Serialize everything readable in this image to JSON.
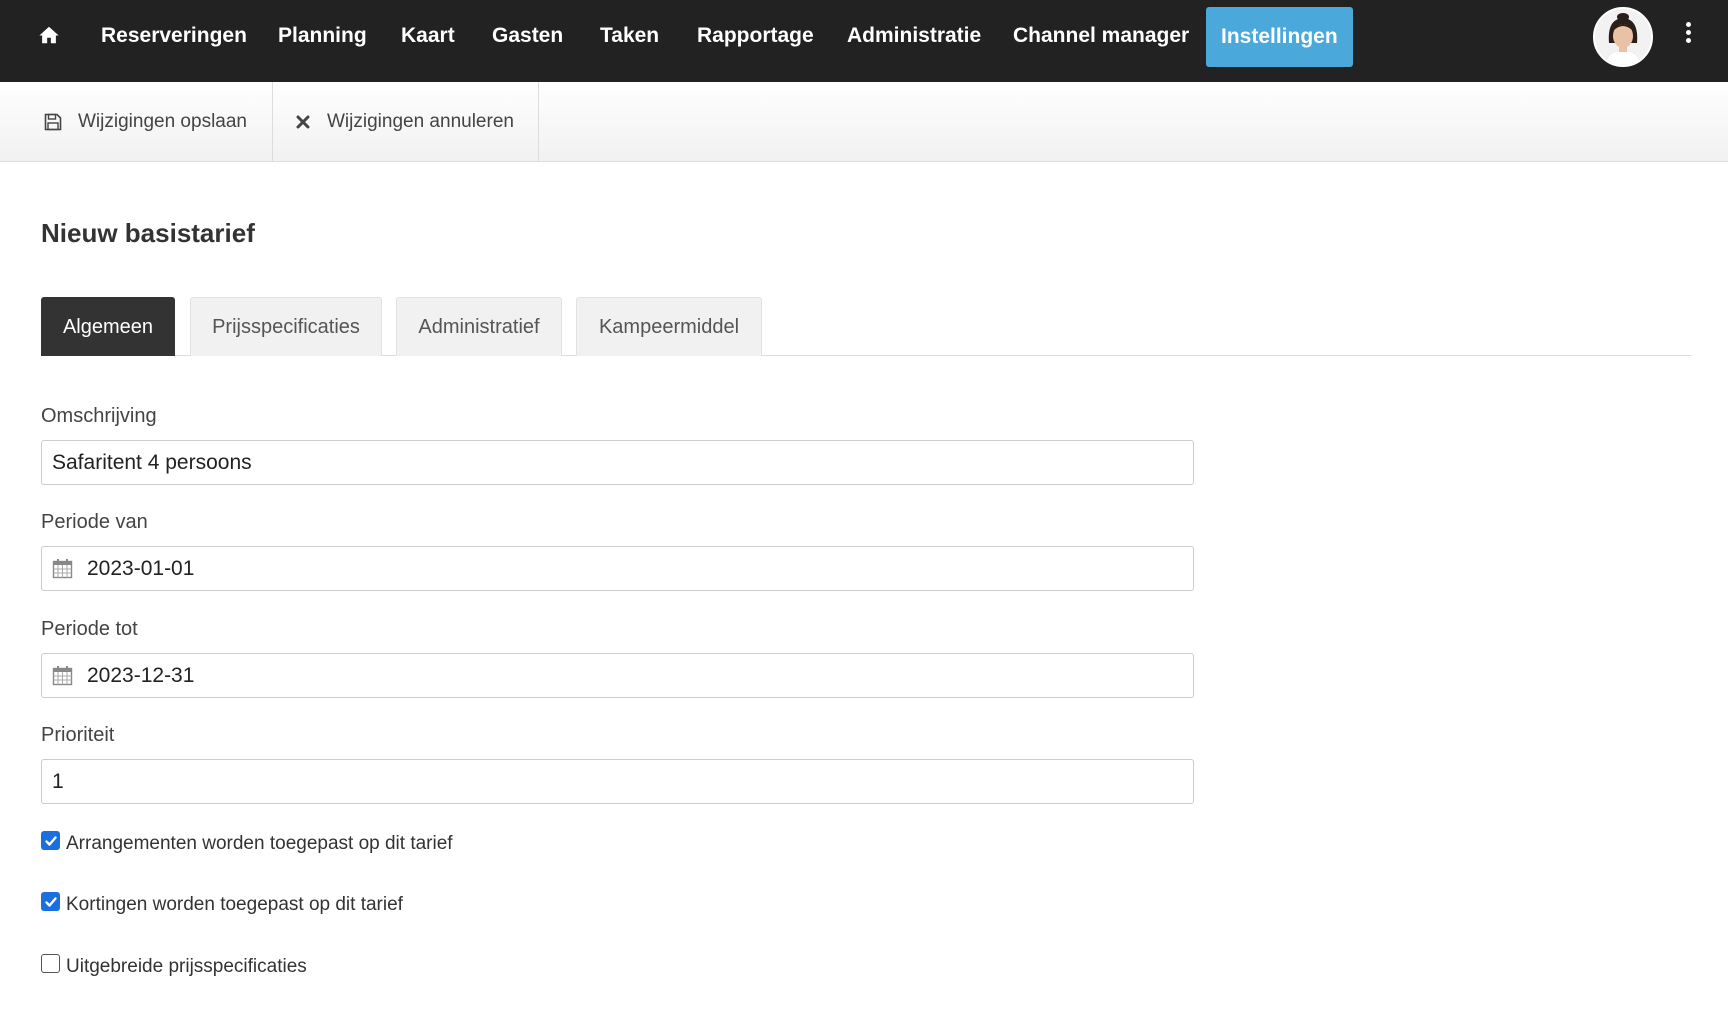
{
  "nav": {
    "items": [
      {
        "label": "Reserveringen"
      },
      {
        "label": "Planning"
      },
      {
        "label": "Kaart"
      },
      {
        "label": "Gasten"
      },
      {
        "label": "Taken"
      },
      {
        "label": "Rapportage"
      },
      {
        "label": "Administratie"
      },
      {
        "label": "Channel manager"
      },
      {
        "label": "Instellingen",
        "active": true
      }
    ],
    "active_color": "#4aa8db",
    "background": "#222222"
  },
  "toolbar": {
    "save_label": "Wijzigingen opslaan",
    "cancel_label": "Wijzigingen annuleren"
  },
  "page": {
    "title": "Nieuw basistarief"
  },
  "tabs": [
    {
      "label": "Algemeen",
      "active": true
    },
    {
      "label": "Prijsspecificaties"
    },
    {
      "label": "Administratief"
    },
    {
      "label": "Kampeermiddel"
    }
  ],
  "form": {
    "omschrijving": {
      "label": "Omschrijving",
      "value": "Safaritent 4 persoons"
    },
    "periode_van": {
      "label": "Periode van",
      "value": "2023-01-01"
    },
    "periode_tot": {
      "label": "Periode tot",
      "value": "2023-12-31"
    },
    "prioriteit": {
      "label": "Prioriteit",
      "value": "1"
    },
    "checkboxes": [
      {
        "label": "Arrangementen worden toegepast op dit tarief",
        "checked": true
      },
      {
        "label": "Kortingen worden toegepast op dit tarief",
        "checked": true
      },
      {
        "label": "Uitgebreide prijsspecificaties",
        "checked": false
      }
    ]
  },
  "icons": {
    "home": "home-icon",
    "save": "floppy-disk-icon",
    "cancel": "close-icon",
    "calendar": "calendar-icon",
    "menu": "kebab-menu-icon"
  },
  "colors": {
    "checkbox_checked": "#1a6fe0",
    "tab_active": "#333333"
  }
}
